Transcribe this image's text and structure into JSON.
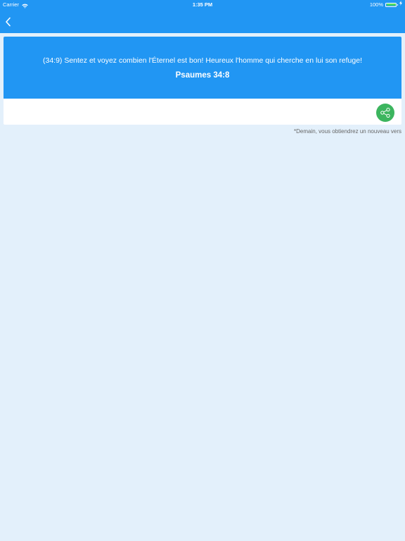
{
  "status_bar": {
    "carrier": "Carrier",
    "time": "1:35 PM",
    "battery_percent": "100%",
    "battery_level": 1.0
  },
  "nav": {
    "back_icon": "chevron-left-icon"
  },
  "verse": {
    "text": "(34:9) Sentez et voyez combien l'Éternel est bon! Heureux l'homme qui cherche en lui son refuge!",
    "reference": "Psaumes 34:8"
  },
  "share": {
    "icon": "share-icon"
  },
  "footnote": "*Demain, vous obtiendrez un nouveau vers",
  "colors": {
    "primary": "#2196f3",
    "background": "#e3f0fb",
    "share": "#3cb55e",
    "battery": "#4cd964"
  }
}
